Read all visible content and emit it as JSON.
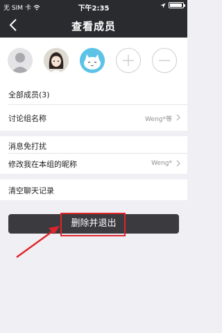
{
  "status_bar": {
    "carrier": "无 SIM 卡",
    "time": "下午2:35",
    "battery_level": 0.95
  },
  "nav": {
    "back_icon": "chevron-left-icon",
    "title": "查看成员"
  },
  "members": [
    {
      "avatar": "default-person-avatar"
    },
    {
      "avatar": "anime-girl-avatar"
    },
    {
      "avatar": "cartoon-cat-avatar"
    }
  ],
  "member_actions": {
    "add_icon": "plus-icon",
    "remove_icon": "minus-icon"
  },
  "settings": {
    "all_members_label": "全部成员(3)",
    "group_name_label": "讨论组名称",
    "group_name_value": "Weng*等",
    "mute_label": "消息免打扰",
    "nickname_label": "修改我在本组的昵称",
    "nickname_value": "Weng*",
    "clear_history_label": "清空聊天记录"
  },
  "delete_button": {
    "label": "删除并退出"
  },
  "annotation": {
    "color": "#e0242b"
  }
}
